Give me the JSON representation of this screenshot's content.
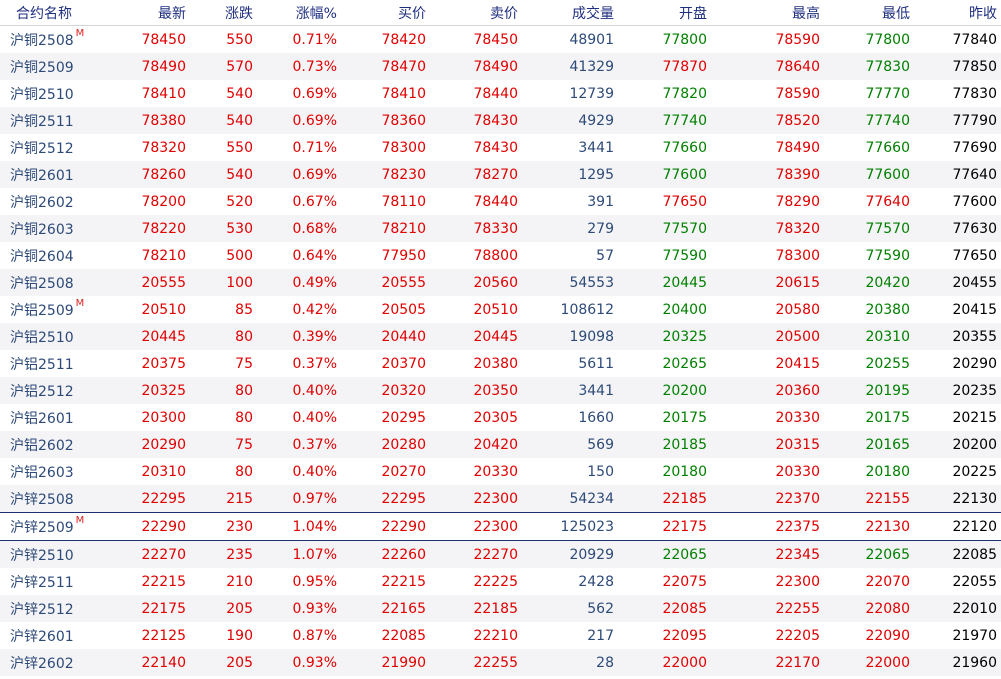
{
  "colors": {
    "up": "#e00000",
    "down": "#008000",
    "volume": "#2d4a78",
    "flat": "#000000",
    "header": "#1f2f80"
  },
  "table": {
    "headers": [
      "合约名称",
      "最新",
      "涨跌",
      "涨幅%",
      "买价",
      "卖价",
      "成交量",
      "开盘",
      "最高",
      "最低",
      "昨收"
    ],
    "rows": [
      {
        "name": "沪铜2508",
        "badge": "M",
        "last": "78450",
        "chg": "550",
        "pct": "0.71%",
        "bid": "78420",
        "ask": "78450",
        "vol": "48901",
        "open": "77800",
        "high": "78590",
        "low": "77800",
        "prev": "77840",
        "selected": false
      },
      {
        "name": "沪铜2509",
        "badge": "",
        "last": "78490",
        "chg": "570",
        "pct": "0.73%",
        "bid": "78470",
        "ask": "78490",
        "vol": "41329",
        "open": "77870",
        "high": "78640",
        "low": "77830",
        "prev": "77850",
        "selected": false
      },
      {
        "name": "沪铜2510",
        "badge": "",
        "last": "78410",
        "chg": "540",
        "pct": "0.69%",
        "bid": "78410",
        "ask": "78440",
        "vol": "12739",
        "open": "77820",
        "high": "78590",
        "low": "77770",
        "prev": "77830",
        "selected": false
      },
      {
        "name": "沪铜2511",
        "badge": "",
        "last": "78380",
        "chg": "540",
        "pct": "0.69%",
        "bid": "78360",
        "ask": "78430",
        "vol": "4929",
        "open": "77740",
        "high": "78520",
        "low": "77740",
        "prev": "77790",
        "selected": false
      },
      {
        "name": "沪铜2512",
        "badge": "",
        "last": "78320",
        "chg": "550",
        "pct": "0.71%",
        "bid": "78300",
        "ask": "78430",
        "vol": "3441",
        "open": "77660",
        "high": "78490",
        "low": "77660",
        "prev": "77690",
        "selected": false
      },
      {
        "name": "沪铜2601",
        "badge": "",
        "last": "78260",
        "chg": "540",
        "pct": "0.69%",
        "bid": "78230",
        "ask": "78270",
        "vol": "1295",
        "open": "77600",
        "high": "78390",
        "low": "77600",
        "prev": "77640",
        "selected": false
      },
      {
        "name": "沪铜2602",
        "badge": "",
        "last": "78200",
        "chg": "520",
        "pct": "0.67%",
        "bid": "78110",
        "ask": "78440",
        "vol": "391",
        "open": "77650",
        "high": "78290",
        "low": "77640",
        "prev": "77600",
        "selected": false
      },
      {
        "name": "沪铜2603",
        "badge": "",
        "last": "78220",
        "chg": "530",
        "pct": "0.68%",
        "bid": "78210",
        "ask": "78330",
        "vol": "279",
        "open": "77570",
        "high": "78320",
        "low": "77570",
        "prev": "77630",
        "selected": false
      },
      {
        "name": "沪铜2604",
        "badge": "",
        "last": "78210",
        "chg": "500",
        "pct": "0.64%",
        "bid": "77950",
        "ask": "78800",
        "vol": "57",
        "open": "77590",
        "high": "78300",
        "low": "77590",
        "prev": "77650",
        "selected": false
      },
      {
        "name": "沪铝2508",
        "badge": "",
        "last": "20555",
        "chg": "100",
        "pct": "0.49%",
        "bid": "20555",
        "ask": "20560",
        "vol": "54553",
        "open": "20445",
        "high": "20615",
        "low": "20420",
        "prev": "20455",
        "selected": false
      },
      {
        "name": "沪铝2509",
        "badge": "M",
        "last": "20510",
        "chg": "85",
        "pct": "0.42%",
        "bid": "20505",
        "ask": "20510",
        "vol": "108612",
        "open": "20400",
        "high": "20580",
        "low": "20380",
        "prev": "20415",
        "selected": false
      },
      {
        "name": "沪铝2510",
        "badge": "",
        "last": "20445",
        "chg": "80",
        "pct": "0.39%",
        "bid": "20440",
        "ask": "20445",
        "vol": "19098",
        "open": "20325",
        "high": "20500",
        "low": "20310",
        "prev": "20355",
        "selected": false
      },
      {
        "name": "沪铝2511",
        "badge": "",
        "last": "20375",
        "chg": "75",
        "pct": "0.37%",
        "bid": "20370",
        "ask": "20380",
        "vol": "5611",
        "open": "20265",
        "high": "20415",
        "low": "20255",
        "prev": "20290",
        "selected": false
      },
      {
        "name": "沪铝2512",
        "badge": "",
        "last": "20325",
        "chg": "80",
        "pct": "0.40%",
        "bid": "20320",
        "ask": "20350",
        "vol": "3441",
        "open": "20200",
        "high": "20360",
        "low": "20195",
        "prev": "20235",
        "selected": false
      },
      {
        "name": "沪铝2601",
        "badge": "",
        "last": "20300",
        "chg": "80",
        "pct": "0.40%",
        "bid": "20295",
        "ask": "20305",
        "vol": "1660",
        "open": "20175",
        "high": "20330",
        "low": "20175",
        "prev": "20215",
        "selected": false
      },
      {
        "name": "沪铝2602",
        "badge": "",
        "last": "20290",
        "chg": "75",
        "pct": "0.37%",
        "bid": "20280",
        "ask": "20420",
        "vol": "569",
        "open": "20185",
        "high": "20315",
        "low": "20165",
        "prev": "20200",
        "selected": false
      },
      {
        "name": "沪铝2603",
        "badge": "",
        "last": "20310",
        "chg": "80",
        "pct": "0.40%",
        "bid": "20270",
        "ask": "20330",
        "vol": "150",
        "open": "20180",
        "high": "20330",
        "low": "20180",
        "prev": "20225",
        "selected": false
      },
      {
        "name": "沪锌2508",
        "badge": "",
        "last": "22295",
        "chg": "215",
        "pct": "0.97%",
        "bid": "22295",
        "ask": "22300",
        "vol": "54234",
        "open": "22185",
        "high": "22370",
        "low": "22155",
        "prev": "22130",
        "selected": false
      },
      {
        "name": "沪锌2509",
        "badge": "M",
        "last": "22290",
        "chg": "230",
        "pct": "1.04%",
        "bid": "22290",
        "ask": "22300",
        "vol": "125023",
        "open": "22175",
        "high": "22375",
        "low": "22130",
        "prev": "22120",
        "selected": true
      },
      {
        "name": "沪锌2510",
        "badge": "",
        "last": "22270",
        "chg": "235",
        "pct": "1.07%",
        "bid": "22260",
        "ask": "22270",
        "vol": "20929",
        "open": "22065",
        "high": "22345",
        "low": "22065",
        "prev": "22085",
        "selected": false
      },
      {
        "name": "沪锌2511",
        "badge": "",
        "last": "22215",
        "chg": "210",
        "pct": "0.95%",
        "bid": "22215",
        "ask": "22225",
        "vol": "2428",
        "open": "22075",
        "high": "22300",
        "low": "22070",
        "prev": "22055",
        "selected": false
      },
      {
        "name": "沪锌2512",
        "badge": "",
        "last": "22175",
        "chg": "205",
        "pct": "0.93%",
        "bid": "22165",
        "ask": "22185",
        "vol": "562",
        "open": "22085",
        "high": "22255",
        "low": "22080",
        "prev": "22010",
        "selected": false
      },
      {
        "name": "沪锌2601",
        "badge": "",
        "last": "22125",
        "chg": "190",
        "pct": "0.87%",
        "bid": "22085",
        "ask": "22210",
        "vol": "217",
        "open": "22095",
        "high": "22205",
        "low": "22090",
        "prev": "21970",
        "selected": false
      },
      {
        "name": "沪锌2602",
        "badge": "",
        "last": "22140",
        "chg": "205",
        "pct": "0.93%",
        "bid": "21990",
        "ask": "22255",
        "vol": "28",
        "open": "22000",
        "high": "22170",
        "low": "22000",
        "prev": "21960",
        "selected": false
      }
    ]
  }
}
